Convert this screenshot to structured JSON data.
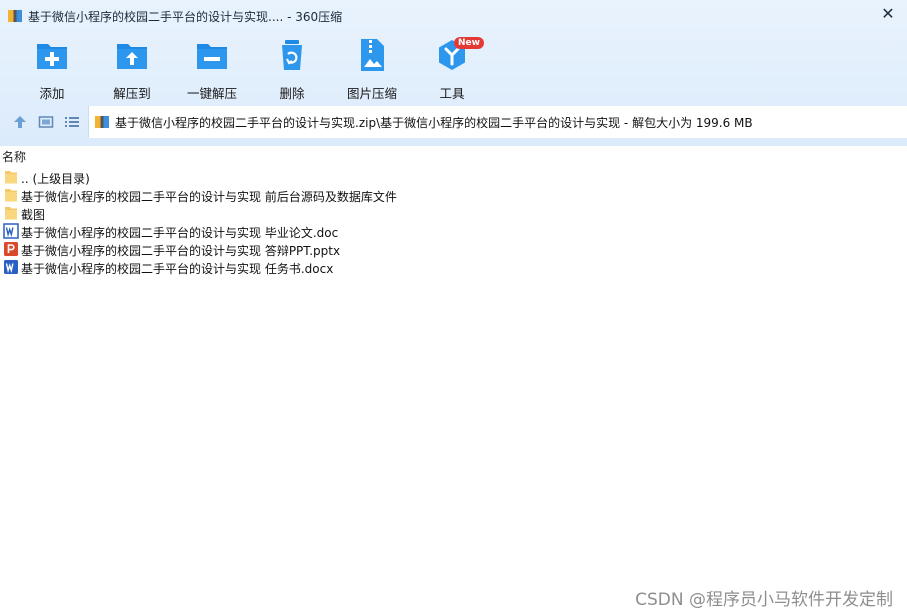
{
  "window": {
    "title": "基于微信小程序的校园二手平台的设计与实现.... - 360压缩",
    "close_glyph": "✕"
  },
  "toolbar": {
    "items": [
      {
        "label": "添加",
        "icon": "add-icon"
      },
      {
        "label": "解压到",
        "icon": "extract-to-icon"
      },
      {
        "label": "一键解压",
        "icon": "one-click-extract-icon"
      },
      {
        "label": "删除",
        "icon": "delete-icon"
      },
      {
        "label": "图片压缩",
        "icon": "image-compress-icon"
      },
      {
        "label": "工具",
        "icon": "tools-icon",
        "badge": "New"
      }
    ]
  },
  "navbar": {
    "path": "基于微信小程序的校园二手平台的设计与实现.zip\\基于微信小程序的校园二手平台的设计与实现 - 解包大小为 199.6 MB"
  },
  "list": {
    "column_name": "名称",
    "rows": [
      {
        "name": ".. (上级目录)",
        "icon": "folder-icon"
      },
      {
        "name": "基于微信小程序的校园二手平台的设计与实现 前后台源码及数据库文件",
        "icon": "folder-icon"
      },
      {
        "name": "截图",
        "icon": "folder-icon"
      },
      {
        "name": "基于微信小程序的校园二手平台的设计与实现 毕业论文.doc",
        "icon": "word-doc-icon"
      },
      {
        "name": "基于微信小程序的校园二手平台的设计与实现 答辩PPT.pptx",
        "icon": "powerpoint-icon"
      },
      {
        "name": "基于微信小程序的校园二手平台的设计与实现 任务书.docx",
        "icon": "word-docx-icon"
      }
    ]
  },
  "watermark": "CSDN @程序员小马软件开发定制",
  "colors": {
    "accent": "#1e88e5",
    "chrome_bg": "#e3effc",
    "badge": "#e53935"
  }
}
